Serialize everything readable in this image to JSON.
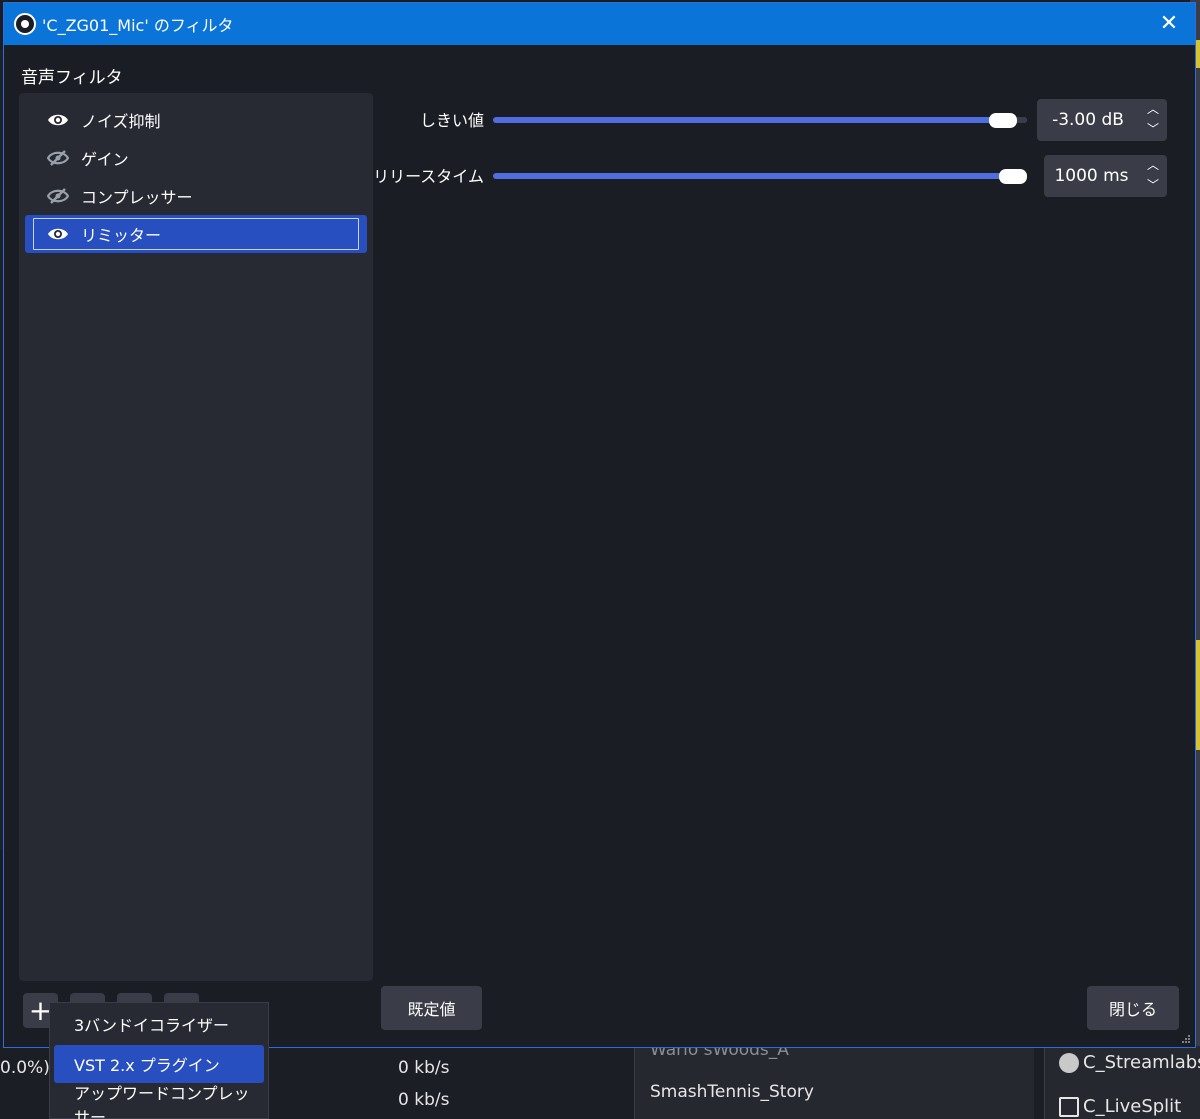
{
  "dialog": {
    "title": "'C_ZG01_Mic' のフィルタ",
    "close_glyph": "✕",
    "section_label": "音声フィルタ"
  },
  "filters": [
    {
      "label": "ノイズ抑制",
      "visible": true,
      "selected": false
    },
    {
      "label": "ゲイン",
      "visible": false,
      "selected": false
    },
    {
      "label": "コンプレッサー",
      "visible": false,
      "selected": false
    },
    {
      "label": "リミッター",
      "visible": true,
      "selected": true
    }
  ],
  "properties": {
    "threshold": {
      "label": "しきい値",
      "value": "-3.00 dB",
      "fraction": 0.98
    },
    "release": {
      "label": "リリースタイム",
      "value": "1000 ms",
      "fraction": 1.0
    }
  },
  "buttons": {
    "defaults": "既定値",
    "close": "閉じる",
    "add": "+"
  },
  "add_menu": [
    {
      "label": "3バンドイコライザー",
      "highlighted": false
    },
    {
      "label": "VST 2.x プラグイン",
      "highlighted": true
    },
    {
      "label": "アップワードコンプレッサー",
      "highlighted": false
    }
  ],
  "background": {
    "left_pct": "0.0%)",
    "rate1": "0 kb/s",
    "rate2": "0 kb/s",
    "scene1": "WarioʼsWoods_A",
    "scene2": "SmashTennis_Story",
    "source1": "C_Streamlabs_",
    "source2": "C_LiveSplit"
  },
  "colors": {
    "titlebar": "#0b74d9",
    "selection": "#284fbf",
    "slider": "#4f6ee0",
    "panel": "#272a33",
    "background": "#1b1d24"
  },
  "icons": {
    "visible": "eye-icon",
    "hidden": "eye-slash-icon"
  }
}
